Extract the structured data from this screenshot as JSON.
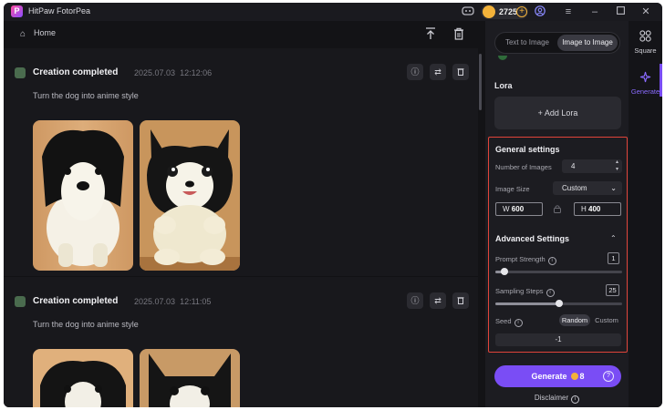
{
  "app": {
    "title": "HitPaw FotorPea",
    "coins": "2725"
  },
  "topbar": {
    "home_label": "Home"
  },
  "feed": {
    "cards": [
      {
        "title": "Creation completed",
        "date": "2025.07.03",
        "time": "12:12:06",
        "prompt": "Turn the dog into anime style"
      },
      {
        "title": "Creation completed",
        "date": "2025.07.03",
        "time": "12:11:05",
        "prompt": "Turn the dog into anime style"
      }
    ]
  },
  "panel": {
    "tabs": [
      "Text to Image",
      "Image to Image"
    ],
    "active_tab": "Image to Image",
    "lora_label": "Lora",
    "add_lora_label": "+ Add Lora",
    "general": {
      "heading": "General settings",
      "num_images_label": "Number of Images",
      "num_images_value": "4",
      "image_size_label": "Image Size",
      "image_size_value": "Custom",
      "width_prefix": "W",
      "width_value": "600",
      "height_prefix": "H",
      "height_value": "400"
    },
    "advanced": {
      "heading": "Advanced Settings",
      "prompt_strength_label": "Prompt Strength",
      "prompt_strength_value": "1",
      "prompt_strength_fraction": 0.07,
      "sampling_steps_label": "Sampling Steps",
      "sampling_steps_value": "25",
      "sampling_steps_fraction": 0.5,
      "seed_label": "Seed",
      "seed_options": [
        "Random",
        "Custom"
      ],
      "seed_selected": "Random",
      "seed_value": "-1"
    },
    "generate_label": "Generate",
    "generate_cost": "8",
    "disclaimer_label": "Disclaimer"
  },
  "rail": {
    "items": [
      "Square",
      "Generate"
    ],
    "active": "Generate"
  },
  "colors": {
    "accent": "#7a4df5",
    "highlight_border": "#e0443a",
    "coin": "#f3b23a"
  }
}
